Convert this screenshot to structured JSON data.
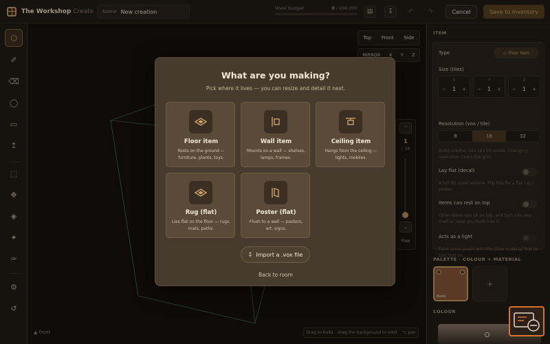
{
  "header": {
    "app_title": "The Workshop",
    "app_section": "Create",
    "name_label": "Name",
    "name_value": "New creation",
    "budget_label": "Voxel budget",
    "budget_used": "0",
    "budget_total": "/ 200,000",
    "budget_fraction": 0,
    "cancel_label": "Cancel",
    "save_label": "Save to Inventory"
  },
  "viewport": {
    "view_tabs": [
      "Top",
      "Front",
      "Side"
    ],
    "mirror_label": "MIRROR",
    "mirror_axes": [
      "X",
      "Y",
      "Z"
    ],
    "layer_current": "1",
    "layer_total": "/ 16",
    "layer_free": "Free",
    "hint_build": "Drag to build",
    "hint_orbit": "drag the background to orbit",
    "hint_pan": "⌥ pan",
    "orientation_label": "front"
  },
  "modal": {
    "title": "What are you making?",
    "subtitle": "Pick where it lives — you can resize and detail it next.",
    "cards": [
      {
        "title": "Floor item",
        "desc": "Rests on the ground — furniture, plants, toys."
      },
      {
        "title": "Wall item",
        "desc": "Mounts on a wall — shelves, lamps, frames."
      },
      {
        "title": "Ceiling item",
        "desc": "Hangs from the ceiling — lights, mobiles."
      },
      {
        "title": "Rug (flat)",
        "desc": "Lies flat on the floor — rugs, mats, paths."
      },
      {
        "title": "Poster (flat)",
        "desc": "Flush to a wall — posters, art, signs."
      }
    ],
    "import_label": "Import a .vox file",
    "back_label": "Back to room"
  },
  "panel": {
    "item_heading": "ITEM",
    "type_label": "Type",
    "type_value": "Floor item",
    "size_label": "Size (tiles)",
    "size_axes": [
      {
        "axis": "X",
        "value": "1"
      },
      {
        "axis": "Y",
        "value": "1"
      },
      {
        "axis": "Z",
        "value": "1"
      }
    ],
    "resolution_label": "Resolution (vox / tile)",
    "resolution_options": [
      "8",
      "16",
      "32"
    ],
    "resolution_selected": "16",
    "resolution_hint": "Build volume: 16×16×16 voxels. Changing resolution clears the grid.",
    "lay_flat_label": "Lay flat (decal)",
    "lay_flat_hint": "A full 3D voxel volume. Flip this for a flat rug / poster.",
    "rest_on_top_label": "Items can rest on top",
    "rest_on_top_hint": "Other items can sit on top, and tuck into any shelf or nook you build into it.",
    "light_label": "Acts as a light",
    "light_hint": "Paint some pixels with the Glow material first to turn this on.",
    "palette_heading": "PALETTE · COLOUR + MATERIAL",
    "swatch_label": "Base",
    "add_swatch": "+",
    "colour_heading": "COLOUR"
  },
  "colors": {
    "accent": "#c9a36a",
    "background": "#1f1a14",
    "modal": "#473b2d",
    "swatch": "#8a5a3a"
  }
}
